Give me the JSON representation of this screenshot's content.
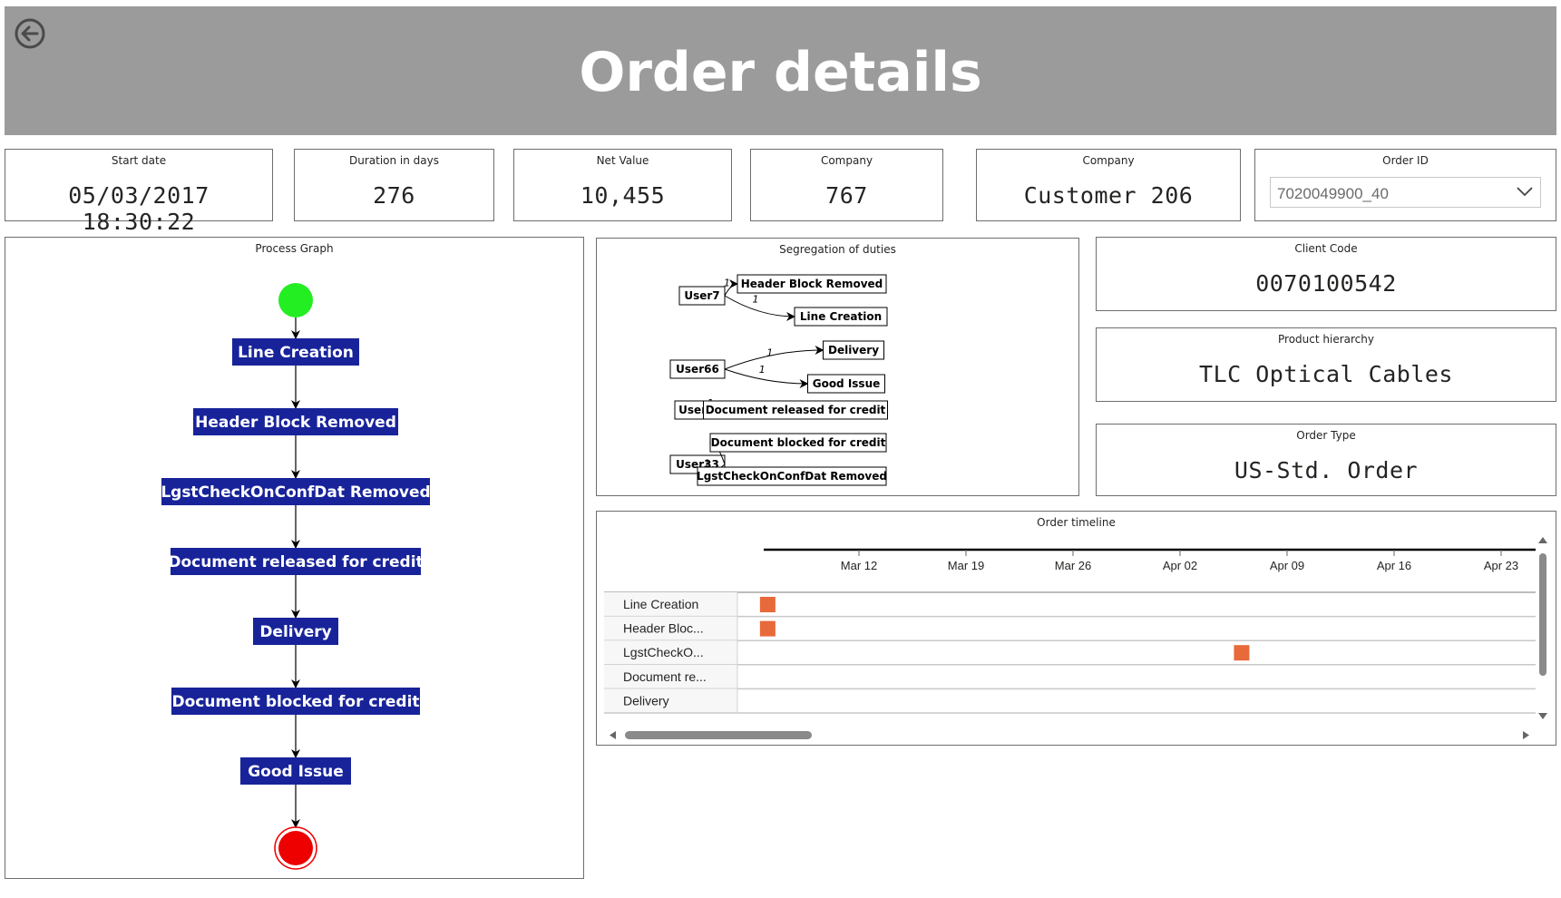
{
  "header": {
    "title": "Order details",
    "back_icon": "back-arrow-icon"
  },
  "kpis": {
    "start_date": {
      "label": "Start date",
      "value": "05/03/2017 18:30:22"
    },
    "duration": {
      "label": "Duration in days",
      "value": "276"
    },
    "net_value": {
      "label": "Net Value",
      "value": "10,455"
    },
    "company_code": {
      "label": "Company",
      "value": "767"
    },
    "company_name": {
      "label": "Company",
      "value": "Customer 206"
    },
    "order_id": {
      "label": "Order ID",
      "value": "7020049900_40"
    }
  },
  "process_graph": {
    "title": "Process Graph",
    "steps": [
      "Line Creation",
      "Header Block Removed",
      "LgstCheckOnConfDat Removed",
      "Document released for credit",
      "Delivery",
      "Document blocked for credit",
      "Good Issue"
    ],
    "start_color": "#22ee22",
    "end_color": "#ee0000",
    "step_color": "#18239a"
  },
  "segregation": {
    "title": "Segregation of duties",
    "groups": [
      {
        "user": "User7",
        "activities": [
          "Header Block Removed",
          "Line Creation"
        ],
        "counts": [
          "1",
          "1"
        ]
      },
      {
        "user": "User66",
        "activities": [
          "Delivery",
          "Good Issue"
        ],
        "counts": [
          "1",
          "1"
        ]
      },
      {
        "user": "User51",
        "activities": [
          "Document released for credit"
        ],
        "counts": [
          "1"
        ]
      },
      {
        "user": "User33",
        "activities": [
          "Document blocked for credit",
          "LgstCheckOnConfDat Removed"
        ],
        "counts": [
          "1",
          "1"
        ]
      }
    ]
  },
  "client_code": {
    "label": "Client Code",
    "value": "0070100542"
  },
  "product_hierarchy": {
    "label": "Product hierarchy",
    "value": "TLC Optical Cables"
  },
  "order_type": {
    "label": "Order Type",
    "value": "US-Std. Order"
  },
  "timeline": {
    "title": "Order timeline",
    "ticks": [
      "Mar 12",
      "Mar 19",
      "Mar 26",
      "Apr 02",
      "Apr 09",
      "Apr 16",
      "Apr 23"
    ],
    "rows": [
      {
        "label": "Line Creation",
        "marker_date": "Mar 06"
      },
      {
        "label": "Header Bloc...",
        "marker_date": "Mar 06"
      },
      {
        "label": "LgstCheckO...",
        "marker_date": "Apr 06"
      },
      {
        "label": "Document re...",
        "marker_date": null
      },
      {
        "label": "Delivery",
        "marker_date": null
      }
    ],
    "marker_color": "#e8693a"
  }
}
